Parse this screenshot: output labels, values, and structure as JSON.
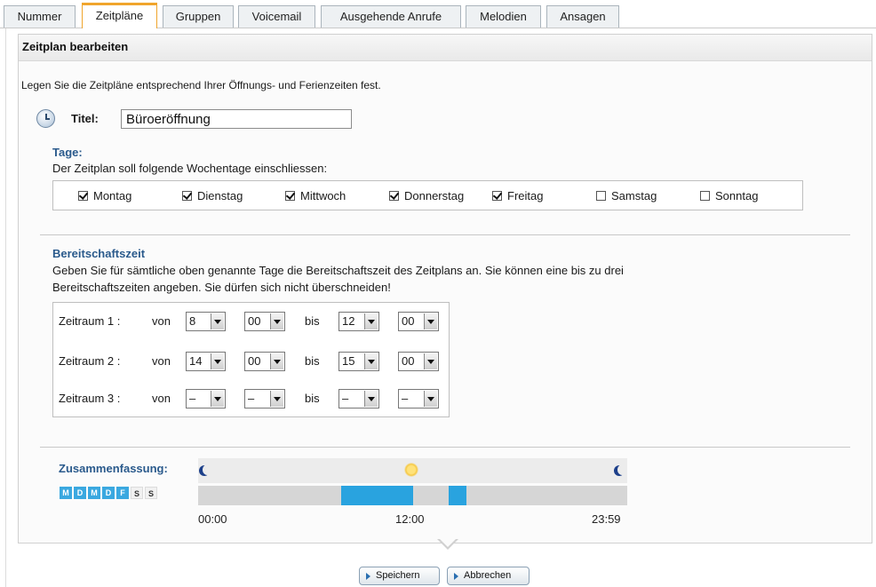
{
  "tabs": [
    {
      "label": "Nummer"
    },
    {
      "label": "Zeitpläne"
    },
    {
      "label": "Gruppen"
    },
    {
      "label": "Voicemail"
    },
    {
      "label": "Ausgehende Anrufe"
    },
    {
      "label": "Melodien"
    },
    {
      "label": "Ansagen"
    }
  ],
  "panel": {
    "title": "Zeitplan bearbeiten",
    "intro": "Legen Sie die Zeitpläne entsprechend Ihrer Öffnungs- und Ferienzeiten fest.",
    "title_label": "Titel:",
    "title_value": "Büroeröffnung"
  },
  "days_section": {
    "heading": "Tage:",
    "description": "Der Zeitplan soll folgende Wochentage einschliessen:",
    "days": [
      {
        "label": "Montag",
        "checked": true
      },
      {
        "label": "Dienstag",
        "checked": true
      },
      {
        "label": "Mittwoch",
        "checked": true
      },
      {
        "label": "Donnerstag",
        "checked": true
      },
      {
        "label": "Freitag",
        "checked": true
      },
      {
        "label": "Samstag",
        "checked": false
      },
      {
        "label": "Sonntag",
        "checked": false
      }
    ]
  },
  "availability": {
    "heading": "Bereitschaftszeit",
    "description_line1": "Geben Sie für sämtliche oben genannte Tage die Bereitschaftszeit des Zeitplans an. Sie können eine bis zu drei",
    "description_line2": "Bereitschaftszeiten angeben. Sie dürfen sich nicht überschneiden!",
    "from_label": "von",
    "to_label": "bis",
    "periods": [
      {
        "label": "Zeitraum 1 :",
        "from_hour": "8",
        "from_min": "00",
        "to_hour": "12",
        "to_min": "00"
      },
      {
        "label": "Zeitraum 2 :",
        "from_hour": "14",
        "from_min": "00",
        "to_hour": "15",
        "to_min": "00"
      },
      {
        "label": "Zeitraum 3 :",
        "from_hour": "–",
        "from_min": "–",
        "to_hour": "–",
        "to_min": "–"
      }
    ]
  },
  "summary": {
    "heading": "Zusammenfassung:",
    "day_letters": [
      {
        "letter": "M",
        "active": true
      },
      {
        "letter": "D",
        "active": true
      },
      {
        "letter": "M",
        "active": true
      },
      {
        "letter": "D",
        "active": true
      },
      {
        "letter": "F",
        "active": true
      },
      {
        "letter": "S",
        "active": false
      },
      {
        "letter": "S",
        "active": false
      }
    ],
    "timeline_start": "00:00",
    "timeline_mid": "12:00",
    "timeline_end": "23:59",
    "active_ranges_hours": [
      [
        8,
        12
      ],
      [
        14,
        15
      ]
    ],
    "colors": {
      "active": "#29a3df",
      "inactive": "#d6d6d6",
      "moon": "#1c3f8a",
      "sun": "#f6c842"
    }
  },
  "buttons": {
    "save": "Speichern",
    "cancel": "Abbrechen"
  }
}
